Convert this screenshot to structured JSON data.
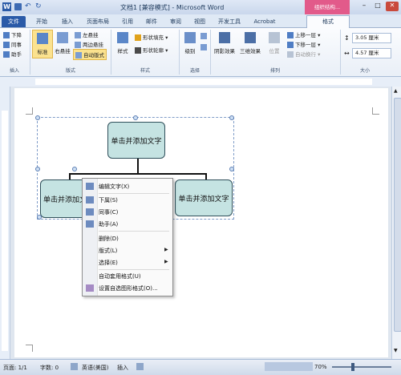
{
  "title": "文档1 [兼容模式] - Microsoft Word",
  "context_tab_group": "组织结构...",
  "tabs": [
    "文件",
    "开始",
    "插入",
    "页面布局",
    "引用",
    "邮件",
    "审阅",
    "视图",
    "开发工具",
    "Acrobat",
    "格式"
  ],
  "ribbon": {
    "create": {
      "items": [
        "下降",
        "同事",
        "助手"
      ],
      "label": "插入"
    },
    "layout": {
      "standard": "标准",
      "right_hanging": "右悬挂",
      "left_hanging": "左悬挂",
      "both_hanging": "两边悬挂",
      "auto_layout": "自动版式",
      "label": "版式"
    },
    "style": {
      "style_btn": "样式",
      "fill": "形状填充",
      "outline": "形状轮廓",
      "label": "样式"
    },
    "select": {
      "btn": "级别",
      "label": "选择"
    },
    "arrange": {
      "shadow": "阴影效果",
      "three_d": "三维效果",
      "position": "位置",
      "bring_forward": "上移一层",
      "send_backward": "下移一层",
      "wrap": "自动换行",
      "label": "排列"
    },
    "size": {
      "height": "3.05 厘米",
      "width": "4.57 厘米",
      "label": "大小"
    }
  },
  "document": {
    "top_shape": "单击并添加文字",
    "left_shape": "单击并添加文字",
    "right_shape": "单击并添加文字"
  },
  "context_menu": {
    "edit_text": "编辑文字(X)",
    "subordinate": "下属(S)",
    "coworker": "同事(C)",
    "assistant": "助手(A)",
    "delete": "删除(D)",
    "layout": "版式(L)",
    "select": "选择(E)",
    "autoformat": "自动套用格式(U)",
    "format_autoshape": "设置自选图形格式(O)..."
  },
  "status": {
    "page": "页面: 1/1",
    "words": "字数: 0",
    "language": "英语(美国)",
    "mode": "插入",
    "zoom": "70%"
  },
  "colors": {
    "shape_fill": "#c5e3e2",
    "file_tab": "#2a5aa8",
    "accent": "#9fb3cf"
  }
}
